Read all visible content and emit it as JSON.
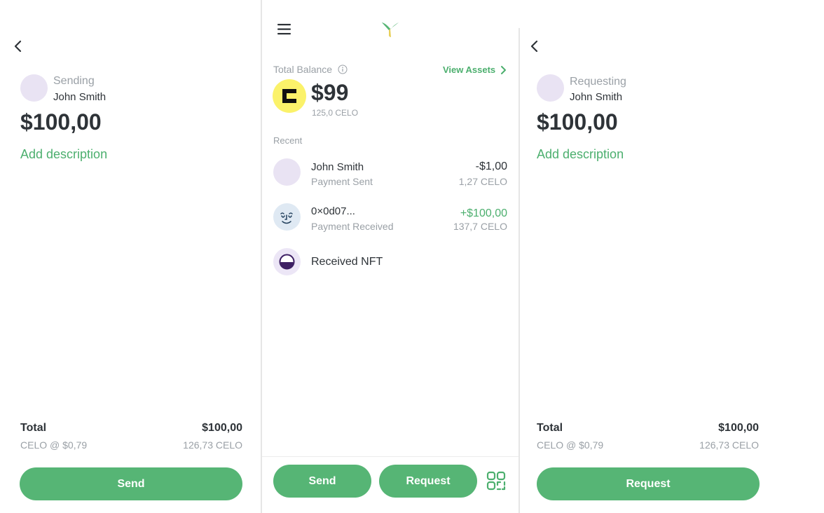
{
  "send_screen": {
    "status_label": "Sending",
    "recipient_name": "John Smith",
    "amount": "$100,00",
    "add_description": "Add description",
    "total_label": "Total",
    "total_value": "$100,00",
    "rate_label": "CELO @ $0,79",
    "celo_amount": "126,73 CELO",
    "action_button": "Send"
  },
  "home_screen": {
    "total_balance_label": "Total Balance",
    "view_assets": "View Assets",
    "balance": "$99",
    "balance_celo": "125,0 CELO",
    "recent_label": "Recent",
    "transactions": [
      {
        "title": "John Smith",
        "subtitle": "Payment Sent",
        "amount": "-$1,00",
        "celo": "1,27 CELO"
      },
      {
        "title": "0×0d07...",
        "subtitle": "Payment Received",
        "amount": "+$100,00",
        "celo": "137,7 CELO"
      },
      {
        "title": "Received NFT"
      }
    ],
    "send_button": "Send",
    "request_button": "Request"
  },
  "request_screen": {
    "status_label": "Requesting",
    "recipient_name": "John Smith",
    "amount": "$100,00",
    "add_description": "Add description",
    "total_label": "Total",
    "total_value": "$100,00",
    "rate_label": "CELO @ $0,79",
    "celo_amount": "126,73 CELO",
    "action_button": "Request"
  },
  "colors": {
    "accent_green": "#56b575",
    "avatar_lavender": "#e9e3f3",
    "celo_yellow": "#fbf26a"
  },
  "icons": [
    "back-icon",
    "menu-icon",
    "app-logo-icon",
    "info-icon",
    "chevron-right-icon",
    "celo-coin-icon",
    "face-avatar-icon",
    "nft-icon",
    "qr-scan-icon"
  ]
}
